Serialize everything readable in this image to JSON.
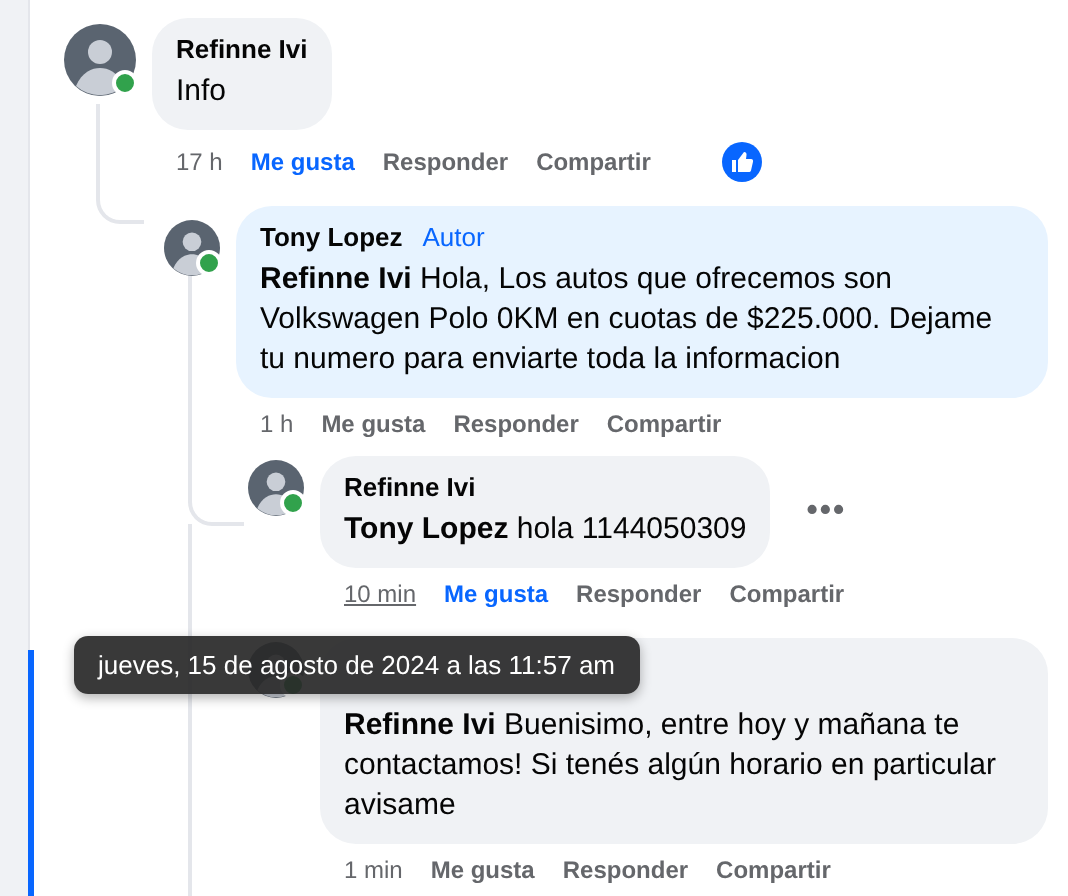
{
  "comments": [
    {
      "author": "Refinne Ivi",
      "text": "Info",
      "time": "17 h",
      "time_hovered": false,
      "liked": true,
      "highlighted": false,
      "online": true,
      "reaction": true,
      "actions": [
        "Me gusta",
        "Responder",
        "Compartir"
      ]
    },
    {
      "author": "Tony Lopez",
      "badge": "Autor",
      "mention": "Refinne Ivi",
      "text": "Hola, Los autos que ofrecemos son Volkswagen Polo 0KM en cuotas de $225.000. Dejame tu numero para enviarte toda la informacion",
      "time": "1 h",
      "time_hovered": false,
      "liked": false,
      "highlighted": true,
      "online": true,
      "actions": [
        "Me gusta",
        "Responder",
        "Compartir"
      ]
    },
    {
      "author": "Refinne Ivi",
      "mention": "Tony Lopez",
      "text": "hola 1144050309",
      "time": "10 min",
      "time_hovered": true,
      "liked": true,
      "highlighted": false,
      "online": true,
      "menu": "•••",
      "actions": [
        "Me gusta",
        "Responder",
        "Compartir"
      ]
    },
    {
      "mention": "Refinne Ivi",
      "text": "Buenisimo, entre hoy y mañana te contactamos! Si tenés algún horario en particular avisame",
      "time": "1 min",
      "time_hovered": false,
      "liked": false,
      "highlighted": false,
      "online": true,
      "actions": [
        "Me gusta",
        "Responder",
        "Compartir"
      ]
    }
  ],
  "tooltip": "jueves, 15 de agosto de 2024 a las 11:57 am"
}
